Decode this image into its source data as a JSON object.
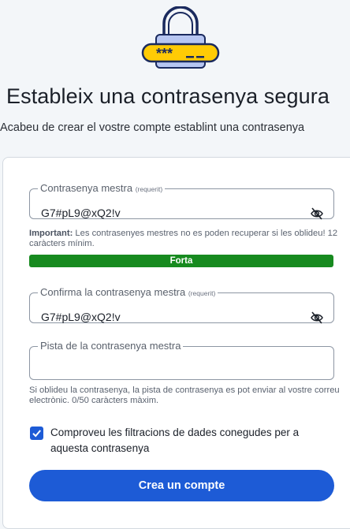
{
  "header": {
    "icon": "lock-password-icon",
    "title": "Estableix una contrasenya segura",
    "subtitle": "Acabeu de crear el vostre compte establint una contrasenya"
  },
  "form": {
    "master_password": {
      "label": "Contrasenya mestra",
      "required": "(requerit)",
      "value": "G7#pL9@xQ2!v",
      "visibility_icon": "eye-slash-icon"
    },
    "master_hint": {
      "important": "Important:",
      "text": " Les contrasenyes mestres no es poden recuperar si les oblideu! 12 caràcters mínim."
    },
    "strength": {
      "label": "Forta",
      "level": 1.0,
      "color": "#178a1f"
    },
    "confirm_password": {
      "label": "Confirma la contrasenya mestra",
      "required": "(requerit)",
      "value": "G7#pL9@xQ2!v",
      "visibility_icon": "eye-slash-icon"
    },
    "password_hint_field": {
      "label": "Pista de la contrasenya mestra",
      "value": ""
    },
    "password_hint_help": "Si oblideu la contrasenya, la pista de contrasenya es pot enviar al vostre correu electrònic. 0/50 caràcters màxim.",
    "breach_check": {
      "checked": true,
      "label": "Comproveu les filtracions de dades conegudes per a aquesta contrasenya"
    },
    "submit_label": "Crea un compte"
  },
  "colors": {
    "accent": "#1d5bd6",
    "background": "#f3f6f9",
    "lock_fill": "#ffcb05"
  }
}
